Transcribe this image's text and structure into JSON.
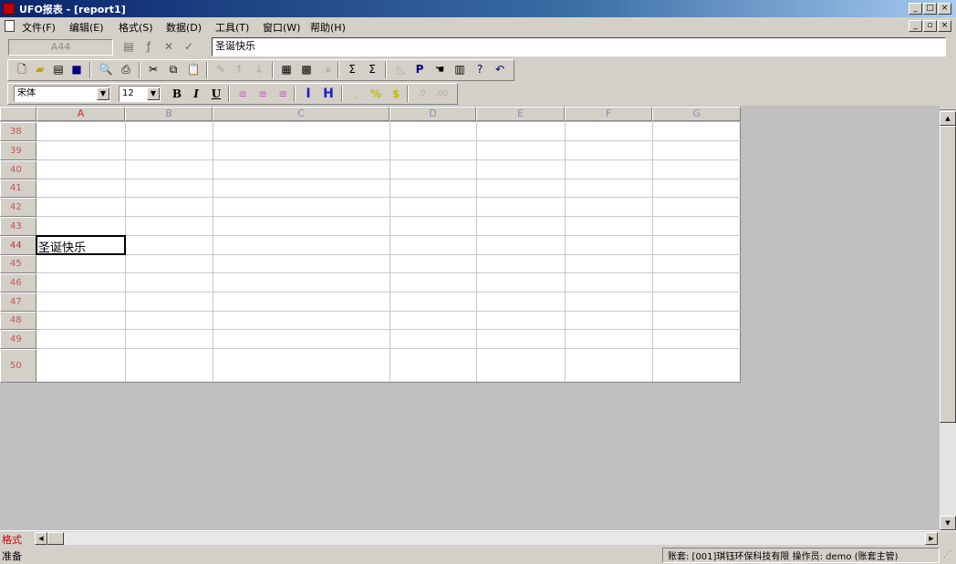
{
  "window": {
    "title": "UFO报表 - [report1]"
  },
  "caption_buttons": {
    "app": [
      "_",
      "□",
      "×"
    ],
    "doc": [
      "_",
      "▫",
      "×"
    ]
  },
  "menu": [
    "文件(F)",
    "编辑(E)",
    "格式(S)",
    "数据(D)",
    "工具(T)",
    "窗口(W)",
    "帮助(H)"
  ],
  "formula_bar": {
    "cell_ref": "A44",
    "value": "圣诞快乐"
  },
  "font_toolbar": {
    "font_name": "宋体",
    "font_size": "12",
    "bold": "B",
    "italic": "I",
    "underline": "U"
  },
  "columns": [
    "A",
    "B",
    "C",
    "D",
    "E",
    "F",
    "G"
  ],
  "rows": [
    "38",
    "39",
    "40",
    "41",
    "42",
    "43",
    "44",
    "45",
    "46",
    "47",
    "48",
    "49",
    "50"
  ],
  "cell_A44": "圣诞快乐",
  "sheet_tab": "格式",
  "status": {
    "left": "准备",
    "right": "账套: [001]琪钰环保科技有限 操作员: demo (账套主管)"
  },
  "colors": {
    "row_header_text": "#b85a5a",
    "title_gradient_start": "#0a246a"
  }
}
